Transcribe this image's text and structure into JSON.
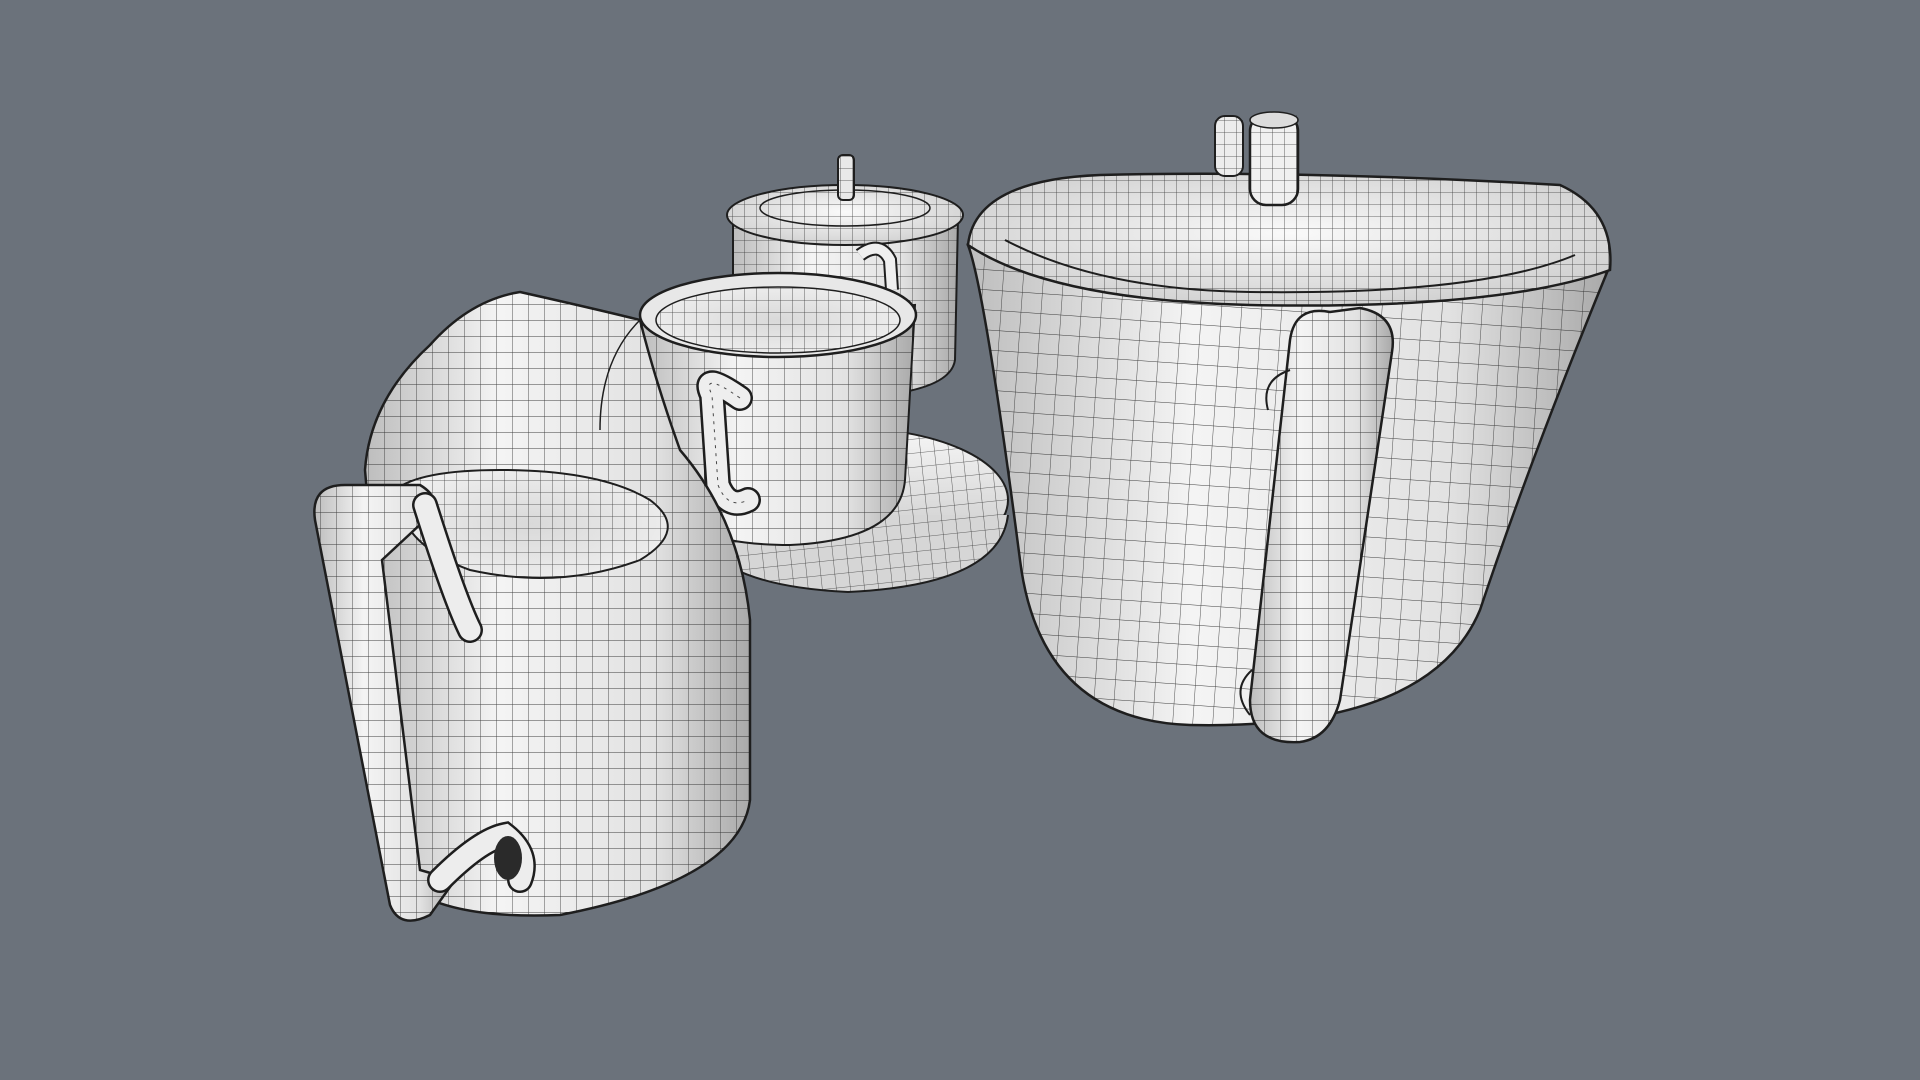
{
  "scene": {
    "background_color": "#6b727b",
    "surface_color": "#f2f2f2",
    "shade_color": "#c9c9c9",
    "wire_color": "#1e1e1e",
    "objects": [
      {
        "name": "sugar-bowl-with-lid"
      },
      {
        "name": "teacup"
      },
      {
        "name": "saucer"
      },
      {
        "name": "milk-jug"
      },
      {
        "name": "teapot-with-lid"
      }
    ]
  }
}
